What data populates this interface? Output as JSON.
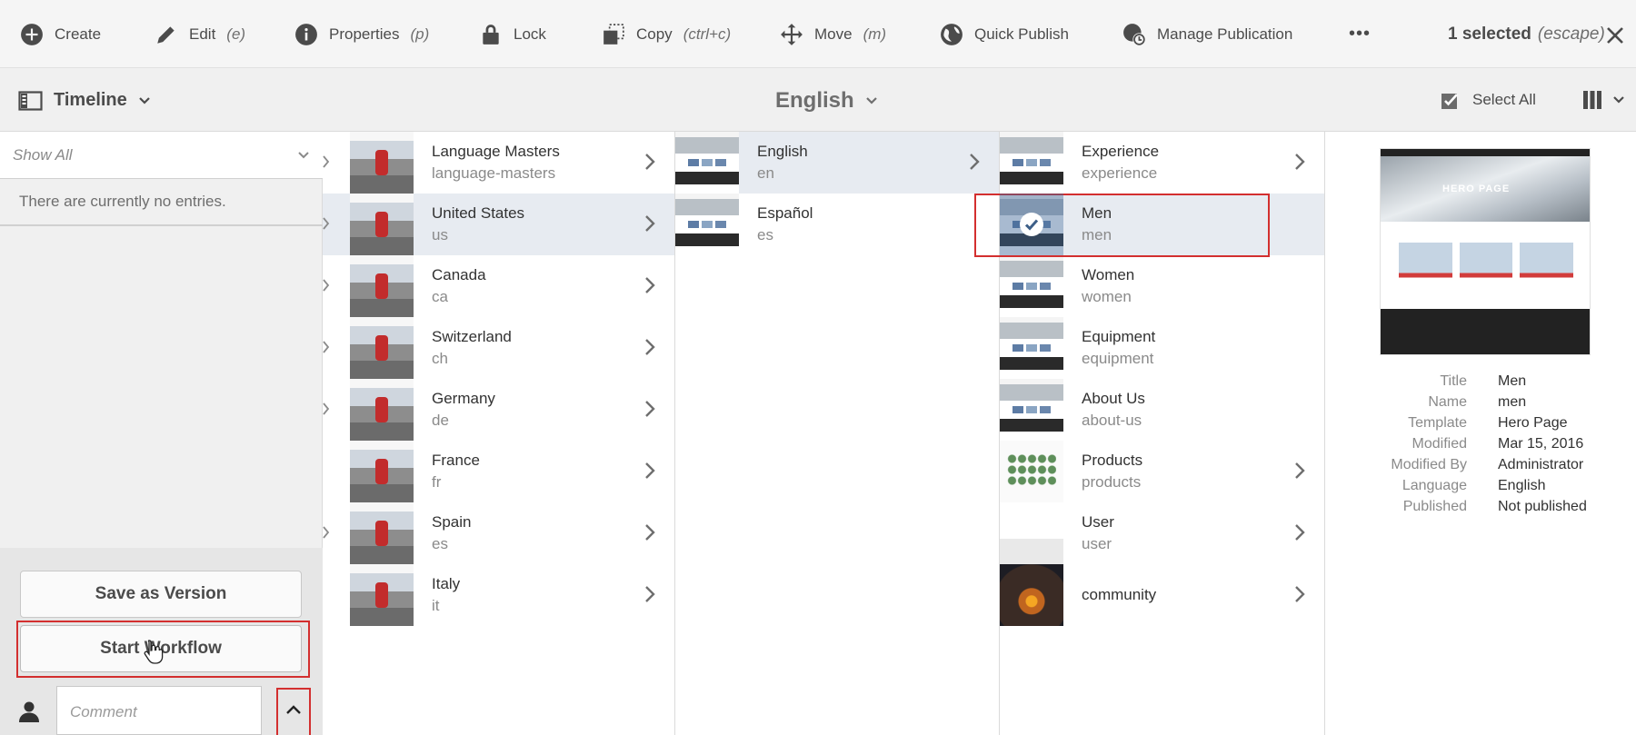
{
  "actionbar": {
    "actions": [
      {
        "label": "Create",
        "hint": ""
      },
      {
        "label": "Edit",
        "hint": "(e)"
      },
      {
        "label": "Properties",
        "hint": "(p)"
      },
      {
        "label": "Lock",
        "hint": ""
      },
      {
        "label": "Copy",
        "hint": "(ctrl+c)"
      },
      {
        "label": "Move",
        "hint": "(m)"
      },
      {
        "label": "Quick Publish",
        "hint": ""
      },
      {
        "label": "Manage Publication",
        "hint": ""
      }
    ],
    "more": "•••",
    "selected_label": "1 selected",
    "selected_hint": "(escape)"
  },
  "secondbar": {
    "rail_label": "Timeline",
    "breadcrumb": "English",
    "select_all": "Select All"
  },
  "rail": {
    "filter": "Show All",
    "no_entries": "There are currently no entries.",
    "save_version": "Save as Version",
    "start_workflow": "Start Workflow",
    "comment_placeholder": "Comment"
  },
  "columns": [
    {
      "items": [
        {
          "title": "Language Masters",
          "name": "language-masters"
        },
        {
          "title": "United States",
          "name": "us"
        },
        {
          "title": "Canada",
          "name": "ca"
        },
        {
          "title": "Switzerland",
          "name": "ch"
        },
        {
          "title": "Germany",
          "name": "de"
        },
        {
          "title": "France",
          "name": "fr"
        },
        {
          "title": "Spain",
          "name": "es"
        },
        {
          "title": "Italy",
          "name": "it"
        }
      ]
    },
    {
      "items": [
        {
          "title": "English",
          "name": "en"
        },
        {
          "title": "Español",
          "name": "es"
        }
      ]
    },
    {
      "items": [
        {
          "title": "Experience",
          "name": "experience"
        },
        {
          "title": "Men",
          "name": "men"
        },
        {
          "title": "Women",
          "name": "women"
        },
        {
          "title": "Equipment",
          "name": "equipment"
        },
        {
          "title": "About Us",
          "name": "about-us"
        },
        {
          "title": "Products",
          "name": "products"
        },
        {
          "title": "User",
          "name": "user"
        },
        {
          "title": "community",
          "name": ""
        }
      ]
    }
  ],
  "preview": {
    "hero_text": "HERO PAGE",
    "meta": [
      {
        "key": "Title",
        "value": "Men"
      },
      {
        "key": "Name",
        "value": "men"
      },
      {
        "key": "Template",
        "value": "Hero Page"
      },
      {
        "key": "Modified",
        "value": "Mar 15, 2016"
      },
      {
        "key": "Modified By",
        "value": "Administrator"
      },
      {
        "key": "Language",
        "value": "English"
      },
      {
        "key": "Published",
        "value": "Not published"
      }
    ]
  },
  "colors": {
    "accent_red": "#d32f2f",
    "selected_row": "#e7ebf1",
    "icon_gray": "#4b4b4b"
  }
}
